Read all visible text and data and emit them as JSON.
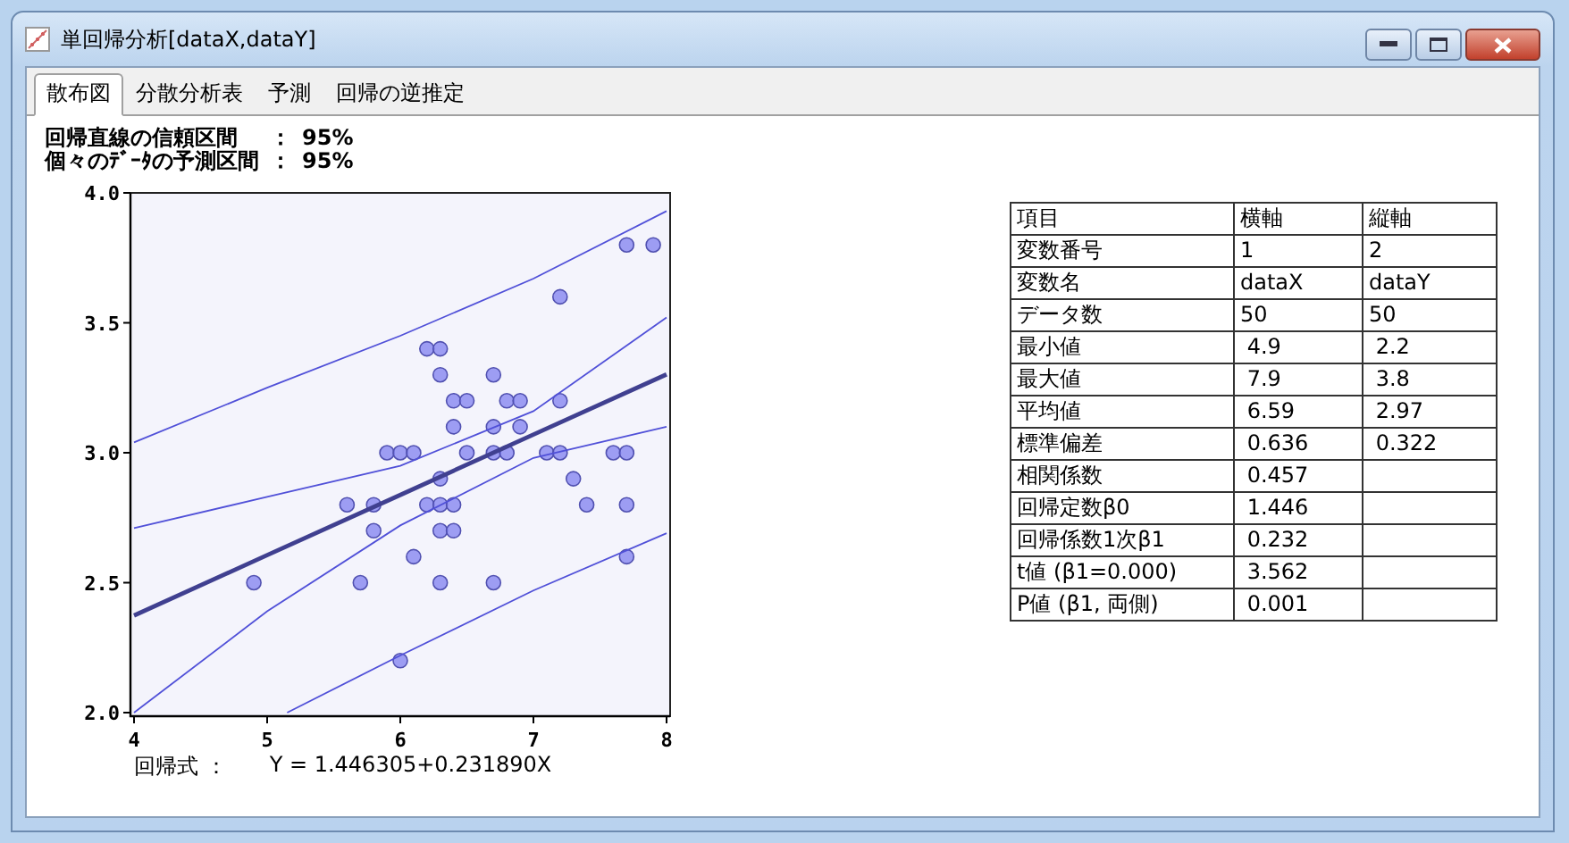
{
  "window": {
    "title": "単回帰分析[dataX,dataY]"
  },
  "tabs": [
    {
      "label": "散布図",
      "selected": true
    },
    {
      "label": "分散分析表",
      "selected": false
    },
    {
      "label": "予測",
      "selected": false
    },
    {
      "label": "回帰の逆推定",
      "selected": false
    }
  ],
  "intervals": [
    {
      "label": "回帰直線の信頼区間",
      "separator": "：",
      "value": "95%"
    },
    {
      "label": "個々のﾃﾞｰﾀの予測区間",
      "separator": "：",
      "value": "95%"
    }
  ],
  "chart_data": {
    "type": "scatter",
    "xlim": [
      4,
      8
    ],
    "ylim": [
      2,
      4
    ],
    "xticks": [
      4,
      5,
      6,
      7,
      8
    ],
    "yticks": [
      {
        "value": 2,
        "label": "2.0"
      },
      {
        "value": 2.5,
        "label": "2.5"
      },
      {
        "value": 3,
        "label": "3.0"
      },
      {
        "value": 3.5,
        "label": "3.5"
      },
      {
        "value": 4,
        "label": "4.0"
      }
    ],
    "series": [
      {
        "type": "scatter",
        "color": "#8080f0",
        "x": [
          4.9,
          5.6,
          5.7,
          5.8,
          5.8,
          5.9,
          6.0,
          6.0,
          6.1,
          6.1,
          6.2,
          6.2,
          6.3,
          6.3,
          6.3,
          6.3,
          6.3,
          6.3,
          6.4,
          6.4,
          6.4,
          6.4,
          6.5,
          6.5,
          6.7,
          6.7,
          6.7,
          6.7,
          6.8,
          6.8,
          6.9,
          6.9,
          7.1,
          7.2,
          7.2,
          7.2,
          7.3,
          7.4,
          7.6,
          7.7,
          7.7,
          7.7,
          7.7,
          7.9
        ],
        "values": [
          2.5,
          2.8,
          2.5,
          2.8,
          2.7,
          3.0,
          3.0,
          2.2,
          3.0,
          2.6,
          3.4,
          2.8,
          3.4,
          3.3,
          2.9,
          2.8,
          2.7,
          2.5,
          3.2,
          3.1,
          2.8,
          2.7,
          3.2,
          3.0,
          3.3,
          3.1,
          3.0,
          2.5,
          3.2,
          3.0,
          3.2,
          3.1,
          3.0,
          3.6,
          3.2,
          3.0,
          2.9,
          2.8,
          3.0,
          3.8,
          3.0,
          2.8,
          2.6,
          3.8
        ]
      },
      {
        "type": "line",
        "color": "#404090",
        "x": [
          4,
          5,
          6,
          7,
          8
        ],
        "values": [
          2.374,
          2.606,
          2.838,
          3.07,
          3.302
        ]
      },
      {
        "type": "line",
        "color": "#5050d8",
        "x": [
          4,
          5,
          6,
          7,
          8
        ],
        "values": [
          2.71,
          2.83,
          2.95,
          3.16,
          3.52
        ]
      },
      {
        "type": "line",
        "color": "#5050d8",
        "x": [
          4,
          5,
          6,
          7,
          8
        ],
        "values": [
          2.0,
          2.39,
          2.72,
          2.98,
          3.1
        ]
      },
      {
        "type": "line",
        "color": "#5050d8",
        "x": [
          4,
          5,
          6,
          7,
          8
        ],
        "values": [
          3.04,
          3.25,
          3.45,
          3.67,
          3.93
        ]
      },
      {
        "type": "line",
        "color": "#5050d8",
        "x": [
          5.15,
          6,
          7,
          8
        ],
        "values": [
          2.0,
          2.22,
          2.47,
          2.69
        ]
      }
    ]
  },
  "equation": {
    "label": "回帰式 ：",
    "formula": "Y = 1.446305+0.231890X"
  },
  "table": {
    "columns": [
      "項目",
      "横軸",
      "縦軸"
    ],
    "rows": [
      [
        "変数番号",
        "1",
        "2"
      ],
      [
        "変数名",
        "dataX",
        "dataY"
      ],
      [
        "データ数",
        "50",
        "50"
      ],
      [
        "最小値",
        " 4.9",
        " 2.2"
      ],
      [
        "最大値",
        " 7.9",
        " 3.8"
      ],
      [
        "平均値",
        " 6.59",
        " 2.97"
      ],
      [
        "標準偏差",
        " 0.636",
        " 0.322"
      ],
      [
        "相関係数",
        " 0.457",
        ""
      ],
      [
        "回帰定数β0",
        " 1.446",
        ""
      ],
      [
        "回帰係数1次β1",
        " 0.232",
        ""
      ],
      [
        "t値 (β1=0.000)",
        " 3.562",
        ""
      ],
      [
        "P値 (β1, 両側)",
        " 0.001",
        ""
      ]
    ]
  }
}
